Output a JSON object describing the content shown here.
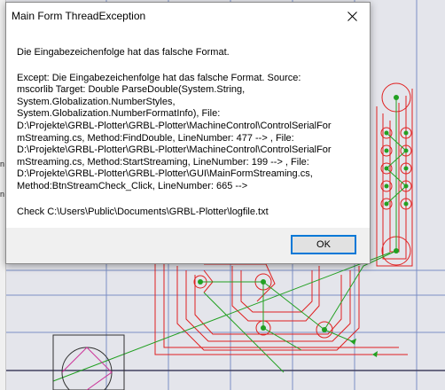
{
  "dialog": {
    "title": "Main Form ThreadException",
    "close_icon": "close-icon",
    "summary": "Die Eingabezeichenfolge hat das falsche Format.",
    "details": "Except: Die Eingabezeichenfolge hat das falsche Format. Source:\nmscorlib Target: Double ParseDouble(System.String,\nSystem.Globalization.NumberStyles,\nSystem.Globalization.NumberFormatInfo), File:\nD:\\Projekte\\GRBL-Plotter\\GRBL-Plotter\\MachineControl\\ControlSerialFor\nmStreaming.cs, Method:FindDouble, LineNumber: 477  -->  , File:\nD:\\Projekte\\GRBL-Plotter\\GRBL-Plotter\\MachineControl\\ControlSerialFor\nmStreaming.cs, Method:StartStreaming, LineNumber: 199  -->  , File:\nD:\\Projekte\\GRBL-Plotter\\GRBL-Plotter\\GUI\\MainFormStreaming.cs,\nMethod:BtnStreamCheck_Click, LineNumber: 665  -->",
    "check_line": "Check C:\\Users\\Public\\Documents\\GRBL-Plotter\\logfile.txt",
    "ok_label": "OK"
  },
  "background": {
    "grid_color": "#7b8fc4",
    "path_color": "#e02020",
    "move_color": "#22a022",
    "tool_color": "#303030"
  },
  "left_strip": {
    "glyph_1": "n",
    "glyph_2": "n"
  }
}
